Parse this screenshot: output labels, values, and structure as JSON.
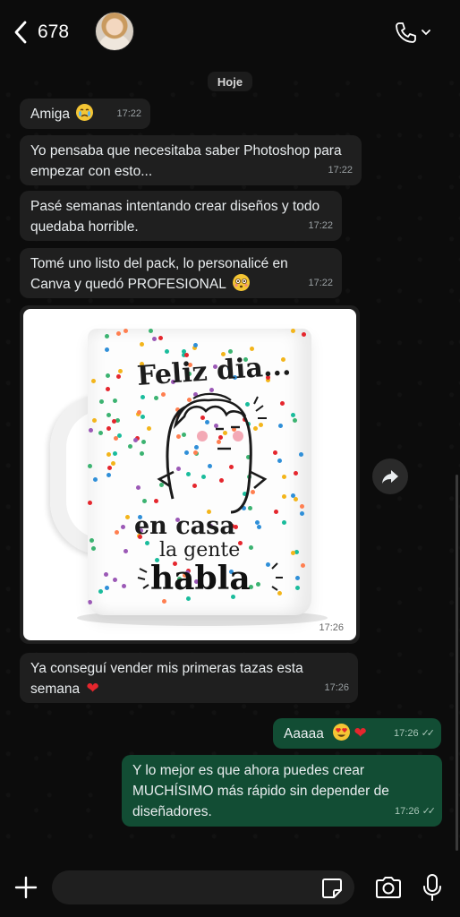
{
  "header": {
    "contact_name": "678",
    "back_icon": "chevron-left-icon",
    "call_icon": "phone-icon"
  },
  "date_chip": "Hoje",
  "messages": [
    {
      "text": "Amiga",
      "time": "17:22",
      "emoji": "crying-face"
    },
    {
      "text": "Yo pensaba que necesitaba saber Photoshop para empezar con esto...",
      "time": "17:22"
    },
    {
      "text": "Pasé semanas intentando crear diseños y todo quedaba horrible.",
      "time": "17:22"
    },
    {
      "text": "Tomé uno listo del pack, lo personalicé en Canva y quedó PROFESIONAL",
      "time": "17:22",
      "emoji": "flushed-face"
    },
    {
      "type": "image",
      "time": "17:26",
      "image_text": [
        "Feliz dia...",
        "en casa",
        "la gente",
        "habla"
      ]
    },
    {
      "text": "Ya conseguí vender mis primeras tazas esta semana",
      "time": "17:26",
      "emoji": "red-heart"
    },
    {
      "text": "Aaaaa",
      "time": "17:26",
      "emoji": "heart-eyes-face red-heart",
      "outgoing": true
    },
    {
      "text": "Y lo mejor es que ahora puedes crear MUCHÍSIMO más rápido sin depender de diseñadores.",
      "time": "17:26",
      "outgoing": true
    }
  ],
  "colors": {
    "incoming_bubble": "#1f1f1f",
    "outgoing_bubble": "#124d34",
    "background": "#0c0c0c"
  }
}
